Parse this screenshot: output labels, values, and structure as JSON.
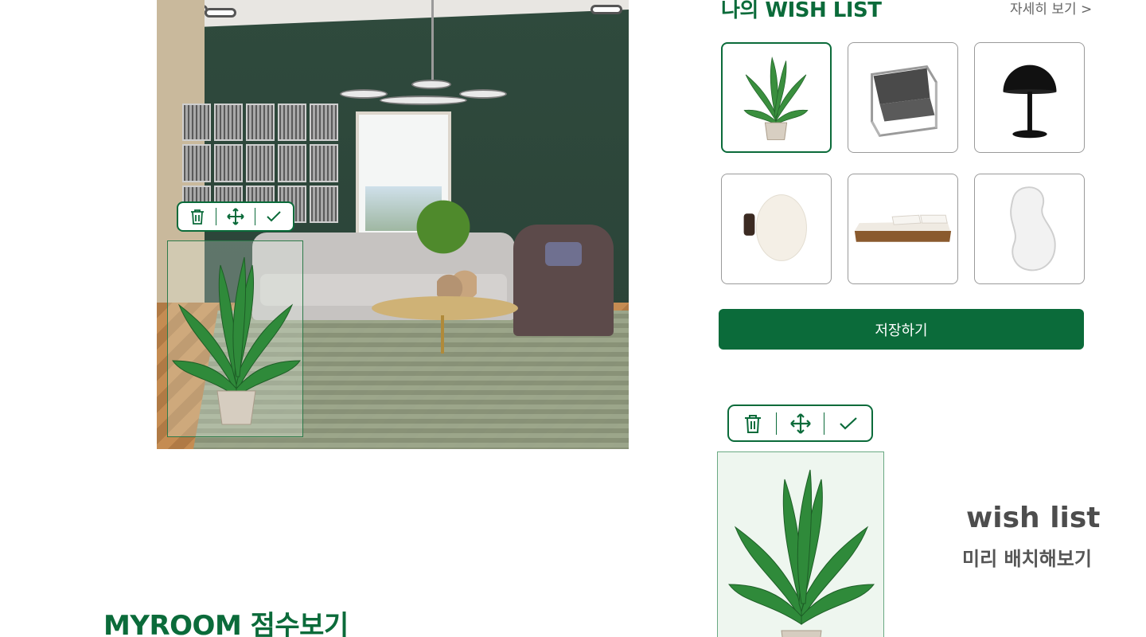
{
  "wishlist": {
    "title": "나의 WISH LIST",
    "more_label": "자세히 보기 >",
    "items": [
      {
        "icon": "potted-plant-icon",
        "selected": true
      },
      {
        "icon": "lounge-chair-icon",
        "selected": false
      },
      {
        "icon": "table-lamp-icon",
        "selected": false
      },
      {
        "icon": "wall-lamp-icon",
        "selected": false
      },
      {
        "icon": "bed-frame-icon",
        "selected": false
      },
      {
        "icon": "wall-mirror-icon",
        "selected": false
      }
    ],
    "save_label": "저장하기"
  },
  "toolbar": {
    "tools": [
      "trash-icon",
      "move-icon",
      "check-icon"
    ]
  },
  "promo": {
    "title": "wish list",
    "subtitle": "미리 배치해보기"
  },
  "section": {
    "title": "MYROOM 점수보기"
  },
  "colors": {
    "brand_green": "#0b6b3a",
    "card_border": "#9a9a9a",
    "text_gray": "#4d4d4d"
  }
}
